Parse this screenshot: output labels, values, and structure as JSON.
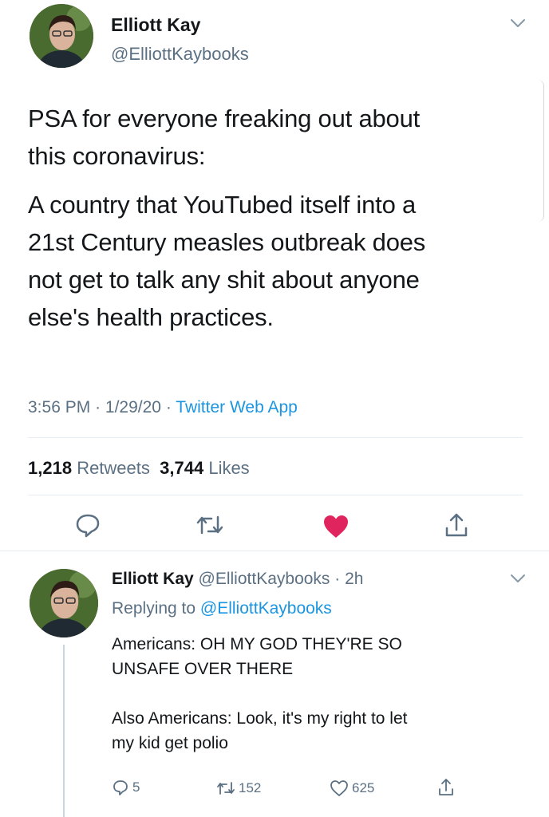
{
  "tweet": {
    "author_name": "Elliott Kay",
    "author_handle": "@ElliottKaybooks",
    "text_para1_line1": "PSA for everyone freaking out about",
    "text_para1_line2": "this coronavirus:",
    "text_para2_line1": "A country that YouTubed itself into a",
    "text_para2_line2": "21st Century measles outbreak does",
    "text_para2_line3": "not get to talk any shit about anyone",
    "text_para2_line4": "else's health practices.",
    "time": "3:56 PM",
    "date": "1/29/20",
    "source": "Twitter Web App",
    "separator": "·",
    "retweets_count": "1,218",
    "retweets_label": "Retweets",
    "likes_count": "3,744",
    "likes_label": "Likes"
  },
  "actions": {
    "reply_icon": "reply-icon",
    "retweet_icon": "retweet-icon",
    "like_icon": "heart-filled-icon",
    "share_icon": "share-icon",
    "like_color": "#e0245e"
  },
  "reply": {
    "author_name": "Elliott Kay",
    "author_handle": "@ElliottKaybooks",
    "separator": "·",
    "time": "2h",
    "replying_prefix": "Replying to",
    "replying_handle": "@ElliottKaybooks",
    "line1": "Americans: OH MY GOD THEY'RE SO",
    "line2": "UNSAFE OVER THERE",
    "line3": "Also Americans: Look, it's my right to let",
    "line4": "my kid get polio",
    "reply_count": "5",
    "retweet_count": "152",
    "like_count": "625"
  },
  "colors": {
    "link_blue": "#1b95e0",
    "secondary_text": "#5b7083",
    "heart_red": "#e0245e"
  }
}
